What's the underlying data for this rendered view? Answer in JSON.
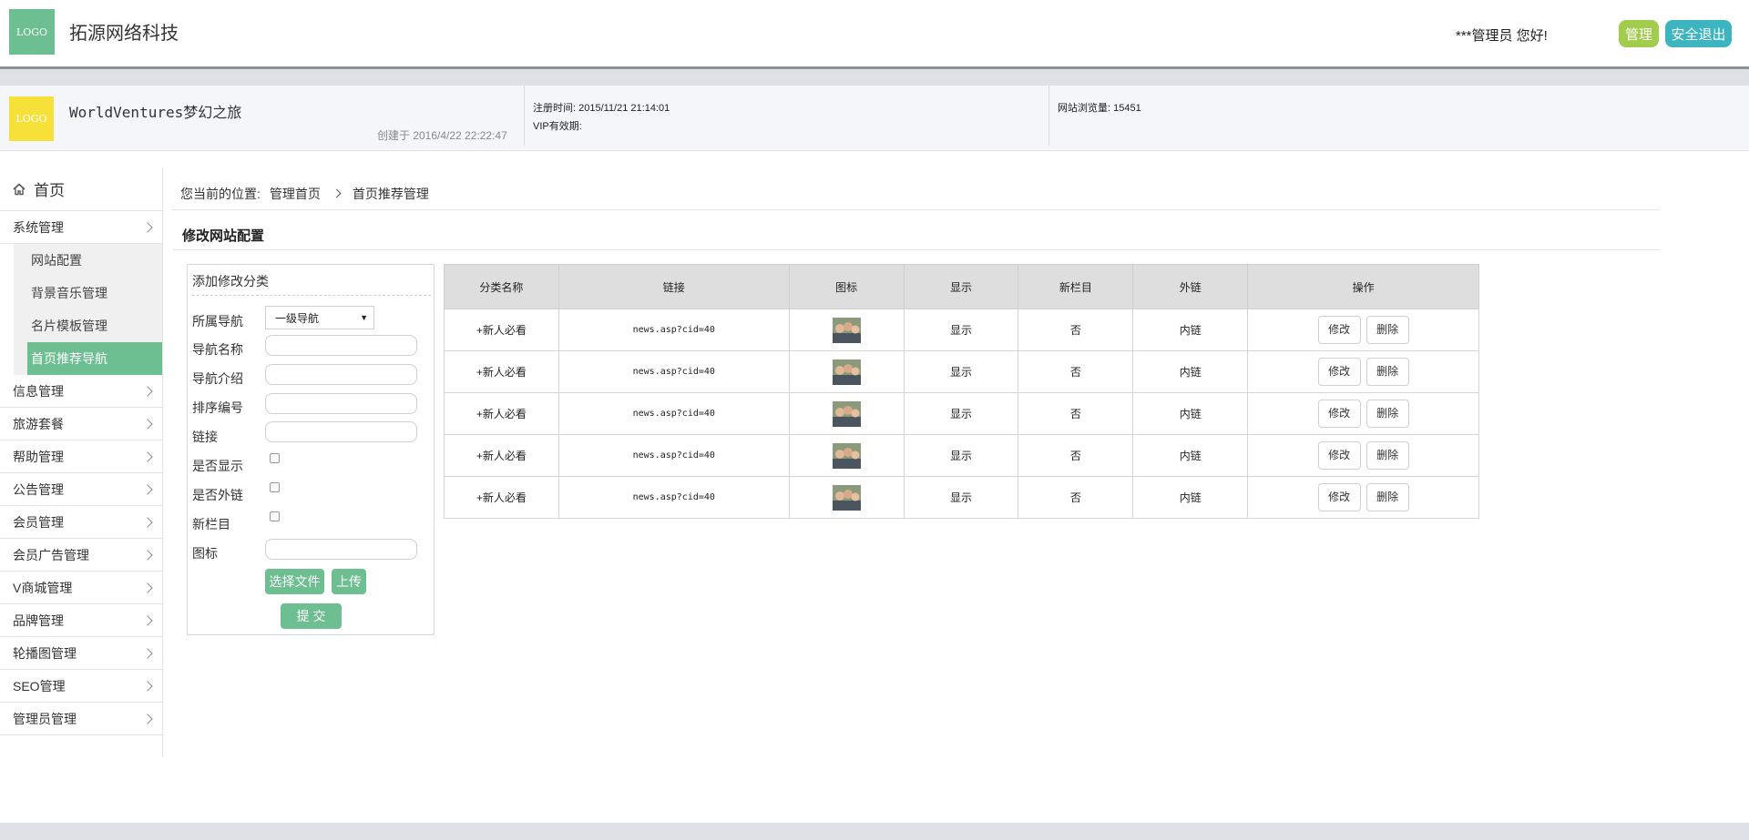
{
  "header": {
    "logo_text": "LOGO",
    "company_name": "拓源网络科技",
    "greeting": "***管理员 您好!",
    "manage_label": "管理",
    "logout_label": "安全退出",
    "colors": {
      "logo": "#6dbf92",
      "manage": "#a2cc4c",
      "logout": "#3db5c0"
    }
  },
  "site_info": {
    "logo_text": "LOGO",
    "site_name": "WorldVentures梦幻之旅",
    "created": "创建于 2016/4/22 22:22:47",
    "register_time": "注册时间: 2015/11/21 21:14:01",
    "vip_expire": "VIP有效期:",
    "page_views": "网站浏览量: 15451"
  },
  "sidebar": {
    "home_label": "首页",
    "home_icon": "home-icon",
    "groups": [
      {
        "label": "系统管理"
      },
      {
        "label": "信息管理"
      },
      {
        "label": "旅游套餐"
      },
      {
        "label": "帮助管理"
      },
      {
        "label": "公告管理"
      },
      {
        "label": "会员管理"
      },
      {
        "label": "会员广告管理"
      },
      {
        "label": "V商城管理"
      },
      {
        "label": "品牌管理"
      },
      {
        "label": "轮播图管理"
      },
      {
        "label": "SEO管理"
      },
      {
        "label": "管理员管理"
      }
    ],
    "sub_items": [
      {
        "label": "网站配置"
      },
      {
        "label": "背景音乐管理"
      },
      {
        "label": "名片模板管理"
      },
      {
        "label": "首页推荐导航",
        "active": true
      }
    ]
  },
  "breadcrumb": {
    "prefix": "您当前的位置:",
    "items": [
      "管理首页",
      "首页推荐管理"
    ]
  },
  "section_title": "修改网站配置",
  "form": {
    "title": "添加修改分类",
    "nav_label": "所属导航",
    "nav_selected": "一级导航",
    "name_label": "导航名称",
    "intro_label": "导航介绍",
    "sort_label": "排序编号",
    "link_label": "链接",
    "show_label": "是否显示",
    "external_label": "是否外链",
    "new_label": "新栏目",
    "icon_label": "图标",
    "choose_file": "选择文件",
    "upload": "上传",
    "submit": "提 交"
  },
  "table": {
    "headers": [
      "分类名称",
      "链接",
      "图标",
      "显示",
      "新栏目",
      "外链",
      "操作"
    ],
    "rows": [
      {
        "name": "+新人必看",
        "link": "news.asp?cid=40",
        "show": "显示",
        "new": "否",
        "external": "内链",
        "edit": "修改",
        "delete": "删除"
      },
      {
        "name": "+新人必看",
        "link": "news.asp?cid=40",
        "show": "显示",
        "new": "否",
        "external": "内链",
        "edit": "修改",
        "delete": "删除"
      },
      {
        "name": "+新人必看",
        "link": "news.asp?cid=40",
        "show": "显示",
        "new": "否",
        "external": "内链",
        "edit": "修改",
        "delete": "删除"
      },
      {
        "name": "+新人必看",
        "link": "news.asp?cid=40",
        "show": "显示",
        "new": "否",
        "external": "内链",
        "edit": "修改",
        "delete": "删除"
      },
      {
        "name": "+新人必看",
        "link": "news.asp?cid=40",
        "show": "显示",
        "new": "否",
        "external": "内链",
        "edit": "修改",
        "delete": "删除"
      }
    ]
  }
}
